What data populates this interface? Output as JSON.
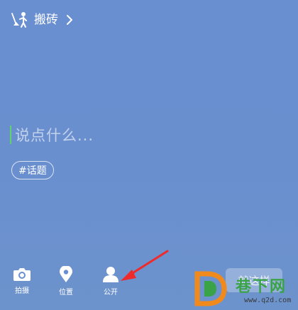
{
  "header": {
    "icon": "broom-scene-icon",
    "title": "搬砖",
    "chevron_icon": "chevron-right-icon"
  },
  "compose": {
    "placeholder": "说点什么..."
  },
  "topic": {
    "label": "#话题"
  },
  "toolbar": {
    "items": [
      {
        "icon": "camera-icon",
        "label": "拍摄"
      },
      {
        "icon": "location-icon",
        "label": "位置"
      },
      {
        "icon": "person-icon",
        "label": "公开"
      }
    ]
  },
  "submit": {
    "label": "就这样"
  },
  "watermark": {
    "text": "巷下网",
    "url": "www.q2d.com"
  },
  "colors": {
    "background": "#6a8fd0",
    "caret": "#5fd26a",
    "arrow": "#ee2a2a",
    "watermark_green": "#3aa348",
    "watermark_orange": "#f08a1c"
  }
}
